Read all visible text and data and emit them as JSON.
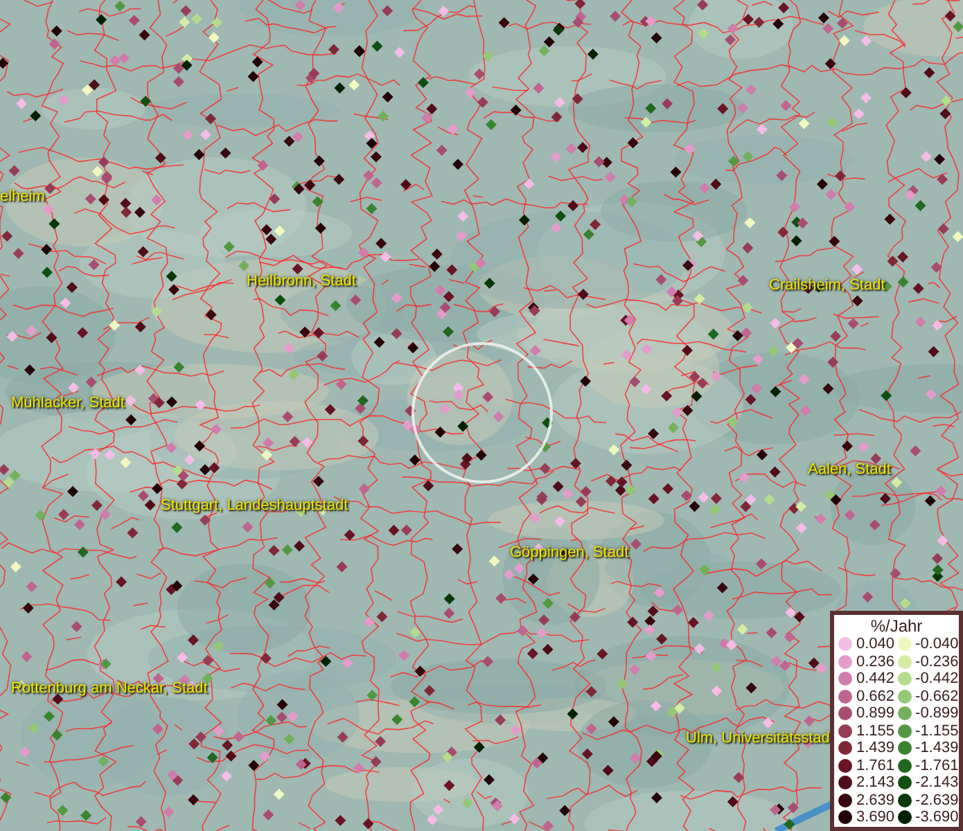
{
  "map": {
    "place_labels": [
      {
        "text": "elheim"
      },
      {
        "text": "Heilbronn, Stadt"
      },
      {
        "text": "Crailsheim, Stadt"
      },
      {
        "text": "Mühlacker, Stadt"
      },
      {
        "text": "Stuttgart, Landeshauptstadt"
      },
      {
        "text": "Aalen, Stadt"
      },
      {
        "text": "Göppingen, Stadt"
      },
      {
        "text": "Rottenburg am Neckar, Stadt"
      },
      {
        "text": "Ulm, Universitätsstad"
      }
    ]
  },
  "legend": {
    "title": "%/Jahr",
    "columns": [
      [
        {
          "value": "0.040",
          "color": "#f4bce6"
        },
        {
          "value": "0.236",
          "color": "#e49ccc"
        },
        {
          "value": "0.442",
          "color": "#d07cac"
        },
        {
          "value": "0.662",
          "color": "#c06490"
        },
        {
          "value": "0.899",
          "color": "#a84c70"
        },
        {
          "value": "1.155",
          "color": "#983c58"
        },
        {
          "value": "1.439",
          "color": "#802838"
        },
        {
          "value": "1.761",
          "color": "#681424"
        },
        {
          "value": "2.143",
          "color": "#500c18"
        },
        {
          "value": "2.639",
          "color": "#38060c"
        },
        {
          "value": "3.690",
          "color": "#220006"
        }
      ],
      [
        {
          "value": "-0.040",
          "color": "#f0f8c0"
        },
        {
          "value": "-0.236",
          "color": "#d4eca4"
        },
        {
          "value": "-0.442",
          "color": "#b4dc8c"
        },
        {
          "value": "-0.662",
          "color": "#94c874"
        },
        {
          "value": "-0.899",
          "color": "#74b05c"
        },
        {
          "value": "-1.155",
          "color": "#549844"
        },
        {
          "value": "-1.439",
          "color": "#3a8430"
        },
        {
          "value": "-1.761",
          "color": "#206820"
        },
        {
          "value": "-2.143",
          "color": "#105010"
        },
        {
          "value": "-2.639",
          "color": "#083808"
        },
        {
          "value": "-3.690",
          "color": "#002000"
        }
      ]
    ]
  }
}
